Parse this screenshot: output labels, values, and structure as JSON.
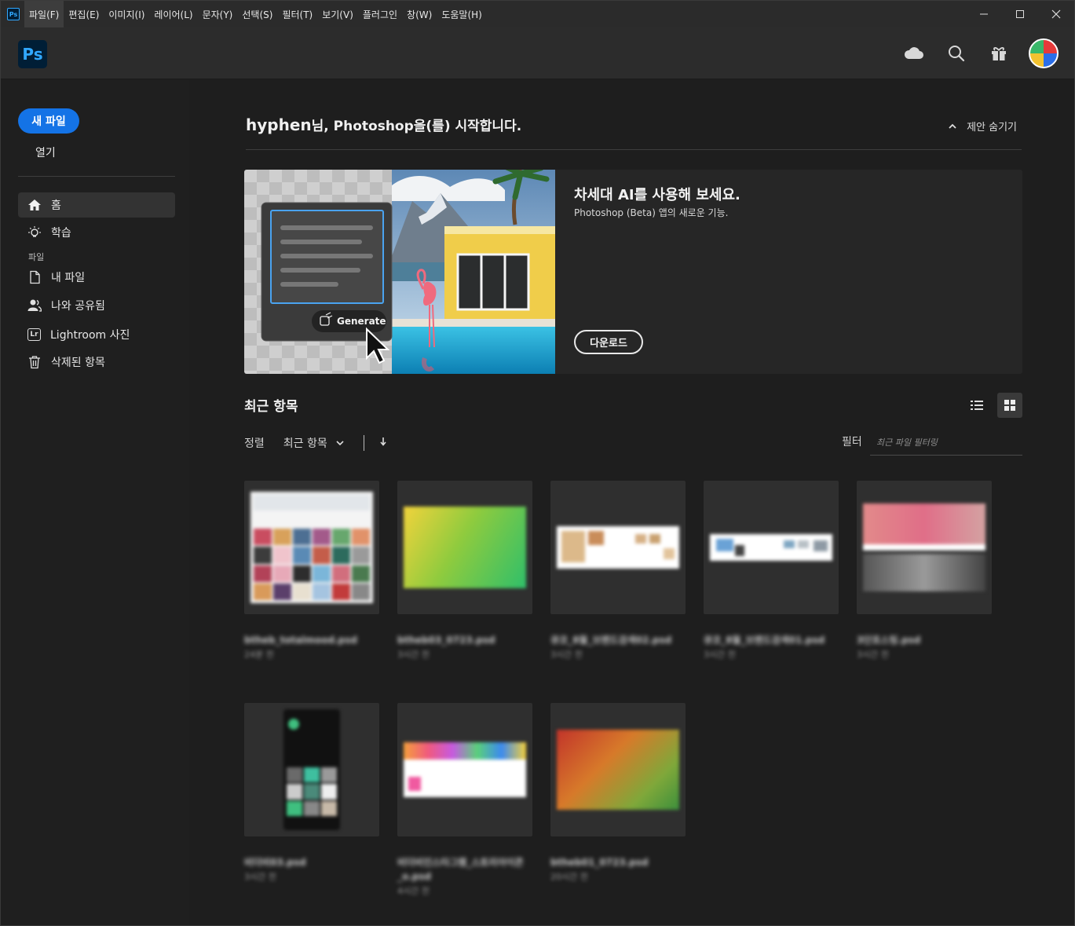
{
  "menubar": {
    "items": [
      "파일(F)",
      "편집(E)",
      "이미지(I)",
      "레이어(L)",
      "문자(Y)",
      "선택(S)",
      "필터(T)",
      "보기(V)",
      "플러그인",
      "창(W)",
      "도움말(H)"
    ]
  },
  "window_controls": {
    "minimize": "—",
    "maximize": "☐",
    "close": "✕"
  },
  "app": {
    "logo": "Ps",
    "small_logo": "Ps"
  },
  "header_icons": [
    "cloud-icon",
    "search-icon",
    "gift-icon",
    "avatar"
  ],
  "sidebar": {
    "new_file": "새 파일",
    "open": "열기",
    "nav": [
      {
        "label": "홈",
        "icon": "home-icon",
        "active": true
      },
      {
        "label": "학습",
        "icon": "lightbulb-icon",
        "active": false
      }
    ],
    "section_header": "파일",
    "files_nav": [
      {
        "label": "내 파일",
        "icon": "document-icon"
      },
      {
        "label": "나와 공유됨",
        "icon": "shared-user-icon"
      },
      {
        "label": "Lightroom 사진",
        "icon": "lightroom-icon",
        "badge": "Lr"
      },
      {
        "label": "삭제된 항목",
        "icon": "trash-icon"
      }
    ]
  },
  "greeting": {
    "user": "hyphen",
    "rest": "님, Photoshop을(를) 시작합니다."
  },
  "hide_suggestions": "제안 숨기기",
  "promo": {
    "title": "차세대 AI를 사용해 보세요.",
    "subtitle": "Photoshop (Beta) 앱의 새로운 기능.",
    "generate_label": "Generate",
    "download": "다운로드"
  },
  "recent": {
    "title": "최근 항목",
    "sort_label": "정렬",
    "sort_value": "최근 항목",
    "filter_label": "필터",
    "filter_placeholder": "최근 파일 필터링",
    "files": [
      {
        "name": "btheb_totalmood.psd",
        "time": "24분 전"
      },
      {
        "name": "btheb03_0723.psd",
        "time": "3시간 전"
      },
      {
        "name": "큐코_8월_브랜드검색02.psd",
        "time": "3시간 전"
      },
      {
        "name": "큐코_8월_브랜드검색01.psd",
        "time": "3시간 전"
      },
      {
        "name": "3단포스팅.psd",
        "time": "3시간 전"
      },
      {
        "name": "비더비03.psd",
        "time": "3시간 전"
      },
      {
        "name": "비더비인스타그램_스토리아이콘_o.psd",
        "time": "4시간 전"
      },
      {
        "name": "btheb01_0723.psd",
        "time": "20시간 전"
      }
    ]
  },
  "colors": {
    "accent": "#1473e6",
    "ps_blue": "#31a8ff",
    "ps_dark": "#001e36",
    "bg": "#1e1e1e"
  }
}
